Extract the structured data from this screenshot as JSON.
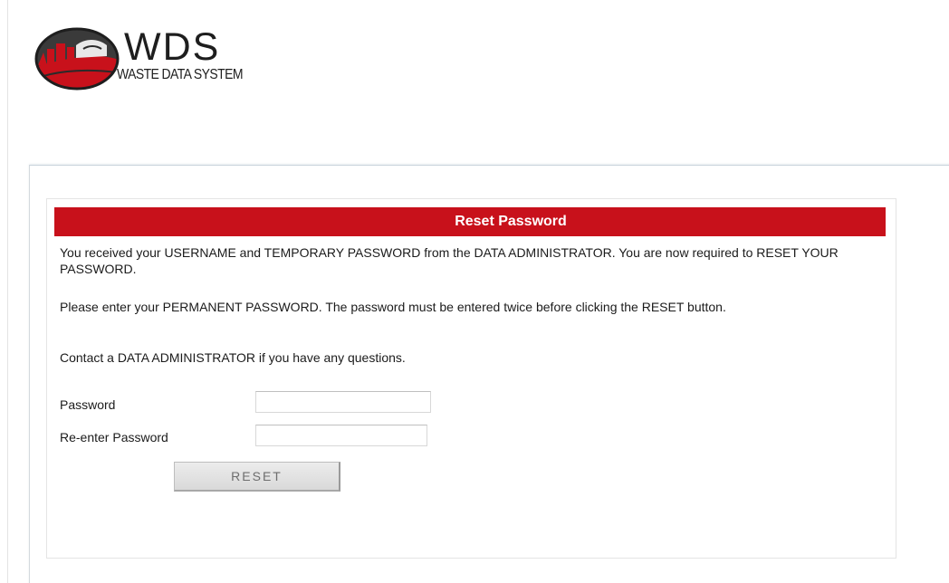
{
  "brand": {
    "logo_icon": "wds-globe-logo-icon",
    "title": "WDS",
    "subtitle": "WASTE DATA SYSTEM",
    "colors": {
      "red": "#c8111b",
      "dark": "#1e1e1e"
    }
  },
  "reset_panel": {
    "header": "Reset Password",
    "header_color": "#c8111b",
    "paragraph1": "You received your USERNAME and TEMPORARY PASSWORD from the DATA ADMINISTRATOR. You are now required to RESET YOUR PASSWORD.",
    "paragraph2": "Please enter your PERMANENT PASSWORD. The password must be entered twice before clicking the RESET button.",
    "paragraph3": "Contact a DATA ADMINISTRATOR if you have any questions.",
    "password_label": "Password",
    "password_value": "",
    "reenter_label": "Re-enter Password",
    "reenter_value": "",
    "reset_button_label": "RESET"
  }
}
